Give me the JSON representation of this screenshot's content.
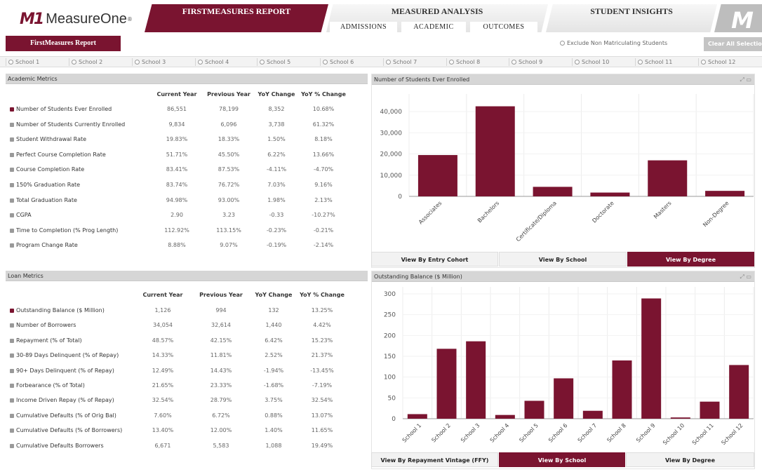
{
  "brand": {
    "logo_mark": "M1",
    "logo_word": "MeasureOne",
    "tm": "®"
  },
  "header_tabs": {
    "firstmeasures": "FIRSTMEASURES REPORT",
    "measured": "MEASURED ANALYSIS",
    "student": "STUDENT INSIGHTS",
    "m1_badge": "M"
  },
  "sub_tabs": {
    "admissions": "ADMISSIONS",
    "academic": "ACADEMIC",
    "outcomes": "OUTCOMES"
  },
  "report_button": "FirstMeasures Report",
  "exclude_label": "Exclude Non Matriculating Students",
  "clear_label": "Clear All Selections",
  "schools": [
    "School 1",
    "School 2",
    "School 3",
    "School 4",
    "School 5",
    "School 6",
    "School 7",
    "School 8",
    "School 9",
    "School 10",
    "School 11",
    "School 12"
  ],
  "academic": {
    "title": "Academic Metrics",
    "headers": [
      "Current Year",
      "Previous Year",
      "YoY Change",
      "YoY % Change"
    ],
    "rows": [
      {
        "label": "Number of Students Ever Enrolled",
        "cur": "86,551",
        "prev": "78,199",
        "chg": "8,352",
        "pct": "10.68%",
        "active": true
      },
      {
        "label": "Number of Students Currently Enrolled",
        "cur": "9,834",
        "prev": "6,096",
        "chg": "3,738",
        "pct": "61.32%",
        "active": false
      },
      {
        "label": "Student Withdrawal Rate",
        "cur": "19.83%",
        "prev": "18.33%",
        "chg": "1.50%",
        "pct": "8.18%",
        "active": false
      },
      {
        "label": "Perfect Course Completion Rate",
        "cur": "51.71%",
        "prev": "45.50%",
        "chg": "6.22%",
        "pct": "13.66%",
        "active": false
      },
      {
        "label": "Course Completion Rate",
        "cur": "83.41%",
        "prev": "87.53%",
        "chg": "-4.11%",
        "pct": "-4.70%",
        "active": false
      },
      {
        "label": "150% Graduation Rate",
        "cur": "83.74%",
        "prev": "76.72%",
        "chg": "7.03%",
        "pct": "9.16%",
        "active": false
      },
      {
        "label": "Total Graduation Rate",
        "cur": "94.98%",
        "prev": "93.00%",
        "chg": "1.98%",
        "pct": "2.13%",
        "active": false
      },
      {
        "label": "CGPA",
        "cur": "2.90",
        "prev": "3.23",
        "chg": "-0.33",
        "pct": "-10.27%",
        "active": false
      },
      {
        "label": "Time to Completion (% Prog Length)",
        "cur": "112.92%",
        "prev": "113.15%",
        "chg": "-0.23%",
        "pct": "-0.21%",
        "active": false
      },
      {
        "label": "Program Change Rate",
        "cur": "8.88%",
        "prev": "9.07%",
        "chg": "-0.19%",
        "pct": "-2.14%",
        "active": false
      }
    ]
  },
  "loan": {
    "title": "Loan Metrics",
    "headers": [
      "Current Year",
      "Previous Year",
      "YoY Change",
      "YoY % Change"
    ],
    "rows": [
      {
        "label": "Outstanding Balance ($ Million)",
        "cur": "1,126",
        "prev": "994",
        "chg": "132",
        "pct": "13.25%",
        "active": true
      },
      {
        "label": "Number of Borrowers",
        "cur": "34,054",
        "prev": "32,614",
        "chg": "1,440",
        "pct": "4.42%",
        "active": false
      },
      {
        "label": "Repayment (% of Total)",
        "cur": "48.57%",
        "prev": "42.15%",
        "chg": "6.42%",
        "pct": "15.23%",
        "active": false
      },
      {
        "label": "30-89 Days Delinquent (% of Repay)",
        "cur": "14.33%",
        "prev": "11.81%",
        "chg": "2.52%",
        "pct": "21.37%",
        "active": false
      },
      {
        "label": "90+ Days Delinquent (% of Repay)",
        "cur": "12.49%",
        "prev": "14.43%",
        "chg": "-1.94%",
        "pct": "-13.45%",
        "active": false
      },
      {
        "label": "Forbearance (% of Total)",
        "cur": "21.65%",
        "prev": "23.33%",
        "chg": "-1.68%",
        "pct": "-7.19%",
        "active": false
      },
      {
        "label": "Income Driven Repay (% of Repay)",
        "cur": "32.54%",
        "prev": "28.79%",
        "chg": "3.75%",
        "pct": "32.54%",
        "active": false
      },
      {
        "label": "Cumulative Defaults (% of Orig Bal)",
        "cur": "7.60%",
        "prev": "6.72%",
        "chg": "0.88%",
        "pct": "13.07%",
        "active": false
      },
      {
        "label": "Cumulative Defaults (% of Borrowers)",
        "cur": "13.40%",
        "prev": "12.00%",
        "chg": "1.40%",
        "pct": "11.65%",
        "active": false
      },
      {
        "label": "Cumulative Defaults Borrowers",
        "cur": "6,671",
        "prev": "5,583",
        "chg": "1,088",
        "pct": "19.49%",
        "active": false
      }
    ]
  },
  "enrolled_buttons": [
    "View By Entry Cohort",
    "View By School",
    "View By Degree"
  ],
  "balance_buttons": [
    "View By Repayment Vintage (FFY)",
    "View By School",
    "View By Degree"
  ],
  "chart_data": [
    {
      "type": "bar",
      "title": "Number of Students Ever Enrolled",
      "categories": [
        "Associates",
        "Bachelors",
        "Certificate/Diploma",
        "Doctorate",
        "Masters",
        "Non-Degree"
      ],
      "values": [
        19500,
        42500,
        4500,
        1800,
        17000,
        2600
      ],
      "ylim": [
        0,
        45000
      ],
      "yticks": [
        0,
        10000,
        20000,
        30000,
        40000
      ],
      "ytick_labels": [
        "0",
        "10,000",
        "20,000",
        "30,000",
        "40,000"
      ],
      "color": "#7a1430",
      "grid": true
    },
    {
      "type": "bar",
      "title": "Outstanding Balance ($ Million)",
      "categories": [
        "School 1",
        "School 2",
        "School 3",
        "School 4",
        "School 5",
        "School 6",
        "School 7",
        "School 8",
        "School 9",
        "School 10",
        "School 11",
        "School 12"
      ],
      "values": [
        11,
        168,
        186,
        9,
        43,
        97,
        19,
        140,
        289,
        3,
        41,
        129
      ],
      "ylim": [
        0,
        300
      ],
      "yticks": [
        0,
        50,
        100,
        150,
        200,
        250,
        300
      ],
      "ytick_labels": [
        "0",
        "50",
        "100",
        "150",
        "200",
        "250",
        "300"
      ],
      "color": "#7a1430",
      "grid": true
    }
  ]
}
